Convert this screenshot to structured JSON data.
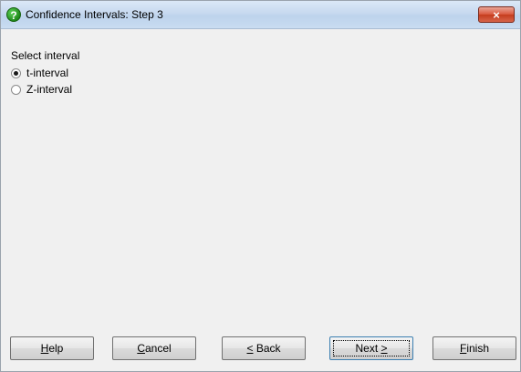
{
  "window": {
    "title": "Confidence Intervals: Step 3",
    "close_symbol": "×"
  },
  "icons": {
    "title_icon": "help-question-icon",
    "title_icon_glyph": "?"
  },
  "section": {
    "label": "Select interval"
  },
  "options": [
    {
      "label": "t-interval",
      "checked": true
    },
    {
      "label": "Z-interval",
      "checked": false
    }
  ],
  "buttons": {
    "help": {
      "hotkey": "H",
      "rest": "elp"
    },
    "cancel": {
      "hotkey": "C",
      "rest": "ancel"
    },
    "back": {
      "hotkey": "<",
      "rest": " Back"
    },
    "next": {
      "prefix": "Next ",
      "hotkey": ">"
    },
    "finish": {
      "hotkey": "F",
      "rest": "inish"
    }
  },
  "colors": {
    "titlebar": "#c7d9ef",
    "close_button": "#c43c1d",
    "panel": "#f0f0f0"
  }
}
